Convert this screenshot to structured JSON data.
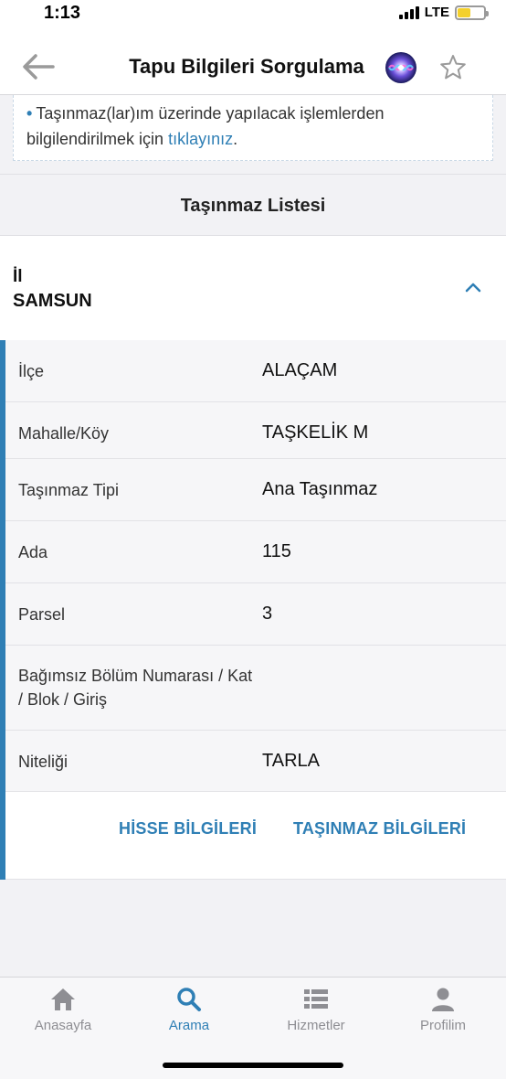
{
  "status_bar": {
    "time": "1:13",
    "network": "LTE"
  },
  "nav": {
    "title": "Tapu Bilgileri Sorgulama"
  },
  "info": {
    "text_before_link": "Taşınmaz(lar)ım üzerinde yapılacak işlemlerden bilgilendirilmek için ",
    "link": "tıklayınız",
    "text_after_link": "."
  },
  "list": {
    "title": "Taşınmaz Listesi",
    "province_label": "İl",
    "province_value": "SAMSUN",
    "rows": [
      {
        "label": "İlçe",
        "value": "ALAÇAM"
      },
      {
        "label": "Mahalle/Köy",
        "value": "TAŞKELİK M"
      },
      {
        "label": "Taşınmaz Tipi",
        "value": "Ana Taşınmaz"
      },
      {
        "label": "Ada",
        "value": "115"
      },
      {
        "label": "Parsel",
        "value": "3"
      },
      {
        "label": "Bağımsız Bölüm Numarası / Kat / Blok / Giriş",
        "value": ""
      },
      {
        "label": "Niteliği",
        "value": "TARLA"
      }
    ],
    "actions": {
      "share": "HİSSE BİLGİLERİ",
      "property": "TAŞINMAZ BİLGİLERİ"
    }
  },
  "tabs": [
    {
      "label": "Anasayfa",
      "icon": "home-icon",
      "active": false
    },
    {
      "label": "Arama",
      "icon": "search-icon",
      "active": true
    },
    {
      "label": "Hizmetler",
      "icon": "list-icon",
      "active": false
    },
    {
      "label": "Profilim",
      "icon": "profile-icon",
      "active": false
    }
  ],
  "colors": {
    "accent": "#2f7fb5",
    "inactive": "#8e8e93"
  }
}
